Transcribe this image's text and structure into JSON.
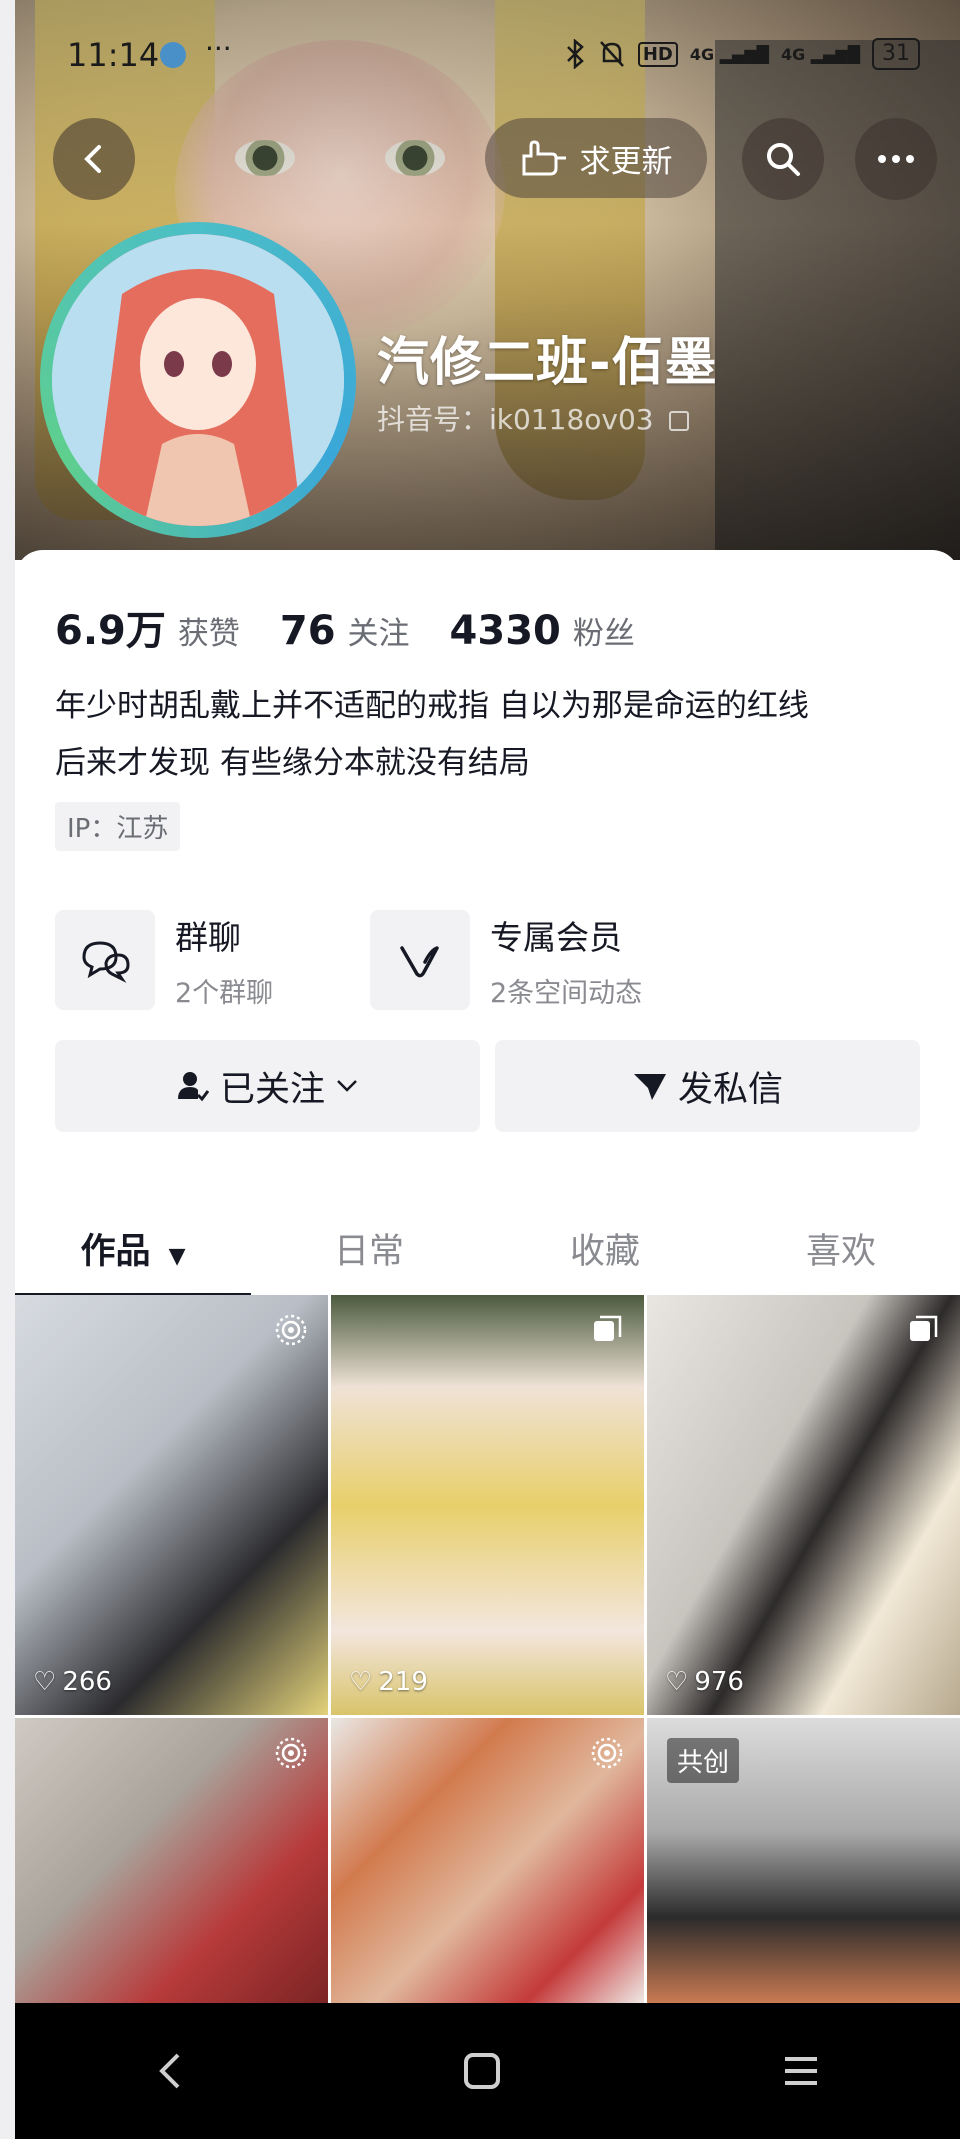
{
  "status_bar": {
    "time": "11:14",
    "network": "HD",
    "signal_1": "4G",
    "signal_2": "4G",
    "battery": "31"
  },
  "header": {
    "update_label": "求更新",
    "nickname": "汽修二班-佰墨",
    "douyin_id": "抖音号：ik0118ov03"
  },
  "stats": [
    {
      "value": "6.9万",
      "label": "获赞"
    },
    {
      "value": "76",
      "label": "关注"
    },
    {
      "value": "4330",
      "label": "粉丝"
    }
  ],
  "bio": {
    "line1": "年少时胡乱戴上并不适配的戒指 自以为那是命运的红线",
    "line2": "后来才发现 有些缘分本就没有结局"
  },
  "ip": "IP：江苏",
  "features": [
    {
      "title": "群聊",
      "subtitle": "2个群聊",
      "icon": "chat-bubbles-icon"
    },
    {
      "title": "专属会员",
      "subtitle": "2条空间动态",
      "icon": "v-logo-icon"
    }
  ],
  "actions": {
    "follow": "已关注",
    "message": "发私信"
  },
  "tabs": [
    {
      "label": "作品",
      "active": true
    },
    {
      "label": "日常",
      "active": false
    },
    {
      "label": "收藏",
      "active": false
    },
    {
      "label": "喜欢",
      "active": false
    }
  ],
  "videos": [
    {
      "likes": "266",
      "badge": "live-icon"
    },
    {
      "likes": "219",
      "badge": "multi-image-icon"
    },
    {
      "likes": "976",
      "badge": "multi-image-icon"
    },
    {
      "likes": "",
      "badge": "live-icon"
    },
    {
      "likes": "",
      "badge": "live-icon"
    },
    {
      "likes": "",
      "badge": "",
      "tag": "共创"
    }
  ],
  "colors": {
    "text": "#161823",
    "secondary": "#8a8b91",
    "card_bg": "#f2f2f4",
    "ring": "#4bbec7"
  }
}
